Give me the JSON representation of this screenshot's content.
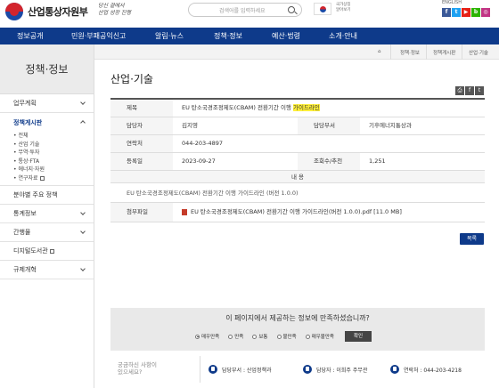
{
  "header": {
    "logo_text": "산업통상자원부",
    "slogan_line1": "당신 곁에서",
    "slogan_line2": "산업 성장 진행",
    "search_placeholder": "검색어를 입력하세요",
    "flag_text1": "국가상징",
    "flag_text2": "알아보기",
    "lang": "ENGLISH",
    "sns": [
      "f",
      "t",
      "▶",
      "b",
      "◎"
    ]
  },
  "nav": [
    "정보공개",
    "민원·부패공익신고",
    "알림·뉴스",
    "정책·정보",
    "예산·법령",
    "소개·안내"
  ],
  "sidebar": {
    "title": "정책·정보",
    "items": [
      {
        "label": "업무계획"
      },
      {
        "label": "정책게시판"
      }
    ],
    "sub_items": [
      "전체",
      "산업 기술",
      "무역·투자",
      "통상·FTA",
      "에너지·자원",
      "연구자료"
    ],
    "items_after": [
      {
        "label": "분야별 주요 정책"
      },
      {
        "label": "통계정보"
      },
      {
        "label": "간행물"
      },
      {
        "label": "디지털도서관"
      },
      {
        "label": "규제개혁"
      }
    ]
  },
  "breadcrumb": [
    "⌂",
    "정책·정보",
    "정책게시판",
    "산업·기술"
  ],
  "page_title": "산업·기술",
  "tools": [
    "⎙",
    "f",
    "t"
  ],
  "view": {
    "title_label": "제목",
    "title_value_prefix": "EU 탄소국경조정제도(CBAM) 전환기간 이행 ",
    "title_value_highlight": "가이드라인",
    "manager_label": "담당자",
    "manager_value": "김지영",
    "dept_label": "담당부서",
    "dept_value": "기후에너지통상과",
    "phone_label": "연락처",
    "phone_value": "044-203-4897",
    "date_label": "등록일",
    "date_value": "2023-09-27",
    "views_label": "조회수/추천",
    "views_value": "1,251",
    "content_label": "내 용",
    "content_text": "EU 탄소국경조정제도(CBAM) 전환기간 이행 가이드라인 (버전 1.0.0)",
    "attach_label": "첨부파일",
    "attach_value": "EU 탄소국경조정제도(CBAM) 전환기간 이행 가이드라인(버전 1.0.0).pdf [11.0 MB]"
  },
  "list_button": "목록",
  "survey": {
    "question": "이 페이지에서 제공하는 정보에 만족하셨습니까?",
    "options": [
      "매우만족",
      "만족",
      "보통",
      "불만족",
      "매우불만족"
    ],
    "selected": 0,
    "confirm": "확인"
  },
  "contact": {
    "question_line1": "궁금하신 사항이",
    "question_line2": "있으세요?",
    "dept": "담당부서 : 산업정책과",
    "person": "담당자 : 이희주 주무관",
    "phone": "연락처 : 044-203-4218"
  },
  "colors": {
    "nav_bg": "#0e3a8a",
    "highlight": "#ffef3a"
  }
}
